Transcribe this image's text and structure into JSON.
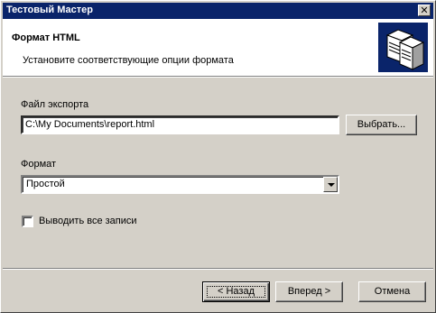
{
  "window": {
    "title": "Тестовый Мастер",
    "close_label": "✕"
  },
  "header": {
    "title": "Формат HTML",
    "subtitle": "Установите соответствующие опции формата",
    "icon": "servers-icon"
  },
  "export_file": {
    "label": "Файл экспорта",
    "value": "C:\\My Documents\\report.html",
    "browse_label": "Выбрать..."
  },
  "format": {
    "label": "Формат",
    "selected": "Простой"
  },
  "output_all": {
    "label": "Выводить все записи",
    "checked": false
  },
  "buttons": {
    "back": "< Назад",
    "next": "Вперед >",
    "cancel": "Отмена"
  },
  "colors": {
    "titlebar": "#0a246a",
    "face": "#d4d0c8"
  }
}
